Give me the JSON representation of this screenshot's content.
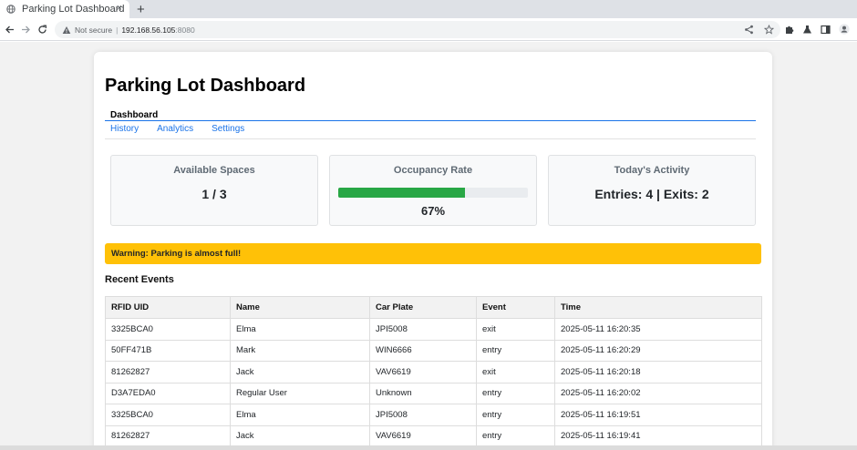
{
  "browser": {
    "tab_title": "Parking Lot Dashboard",
    "tab_close": "×",
    "new_tab": "+",
    "security_label": "Not secure",
    "separator": "|",
    "url_host": "192.168.56.105",
    "url_port": ":8080"
  },
  "page": {
    "title": "Parking Lot Dashboard",
    "nav": {
      "active": "Dashboard",
      "links": [
        "History",
        "Analytics",
        "Settings"
      ]
    },
    "cards": {
      "available": {
        "title": "Available Spaces",
        "value": "1 / 3"
      },
      "occupancy": {
        "title": "Occupancy Rate",
        "value": "67%",
        "fraction": 0.67,
        "bar_color": "#28a745"
      },
      "activity": {
        "title": "Today's Activity",
        "value": "Entries: 4 | Exits: 2"
      }
    },
    "alert": {
      "text": "Warning: Parking is almost full!",
      "color": "#ffc107"
    },
    "recent_events": {
      "title": "Recent Events",
      "columns": [
        "RFID UID",
        "Name",
        "Car Plate",
        "Event",
        "Time"
      ],
      "rows": [
        [
          "3325BCA0",
          "Elma",
          "JPI5008",
          "exit",
          "2025-05-11 16:20:35"
        ],
        [
          "50FF471B",
          "Mark",
          "WIN6666",
          "entry",
          "2025-05-11 16:20:29"
        ],
        [
          "81262827",
          "Jack",
          "VAV6619",
          "exit",
          "2025-05-11 16:20:18"
        ],
        [
          "D3A7EDA0",
          "Regular User",
          "Unknown",
          "entry",
          "2025-05-11 16:20:02"
        ],
        [
          "3325BCA0",
          "Elma",
          "JPI5008",
          "entry",
          "2025-05-11 16:19:51"
        ],
        [
          "81262827",
          "Jack",
          "VAV6619",
          "entry",
          "2025-05-11 16:19:41"
        ]
      ]
    }
  },
  "colors": {
    "accent": "#1a73e8",
    "success": "#28a745",
    "warning": "#ffc107"
  }
}
